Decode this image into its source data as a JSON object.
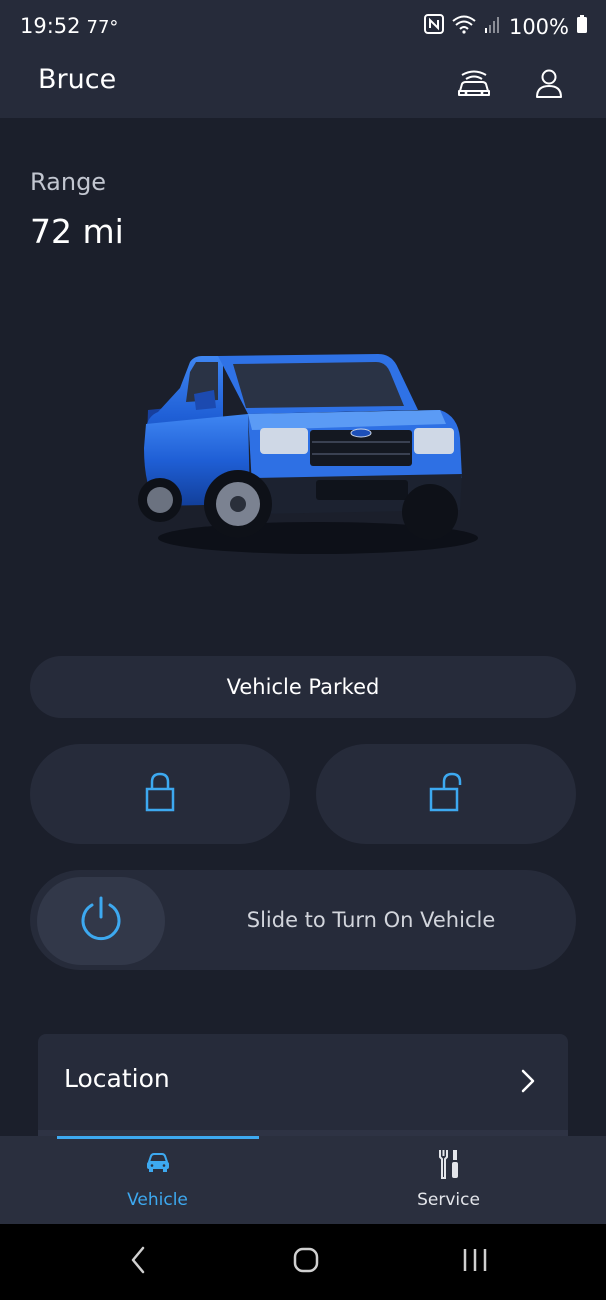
{
  "status_bar": {
    "time": "19:52",
    "temperature": "77°",
    "battery": "100%",
    "icons": [
      "nfc-icon",
      "wifi-icon",
      "signal-icon",
      "battery-icon"
    ]
  },
  "header": {
    "title": "Bruce",
    "icons": [
      "connected-vehicle-icon",
      "account-icon"
    ]
  },
  "range": {
    "label": "Range",
    "value": "72 mi"
  },
  "vehicle": {
    "status": "Vehicle Parked",
    "body_color": "#1f5fd6"
  },
  "controls": {
    "lock_icon": "lock-icon",
    "unlock_icon": "unlock-icon",
    "slider_label": "Slide to Turn On Vehicle",
    "power_icon": "power-icon"
  },
  "location": {
    "label": "Location"
  },
  "bottom_nav": {
    "items": [
      {
        "label": "Vehicle",
        "icon": "car-icon",
        "active": true
      },
      {
        "label": "Service",
        "icon": "tools-icon",
        "active": false
      }
    ],
    "accent": "#3da9f0"
  },
  "system_nav": [
    "back-icon",
    "home-icon",
    "recents-icon"
  ]
}
